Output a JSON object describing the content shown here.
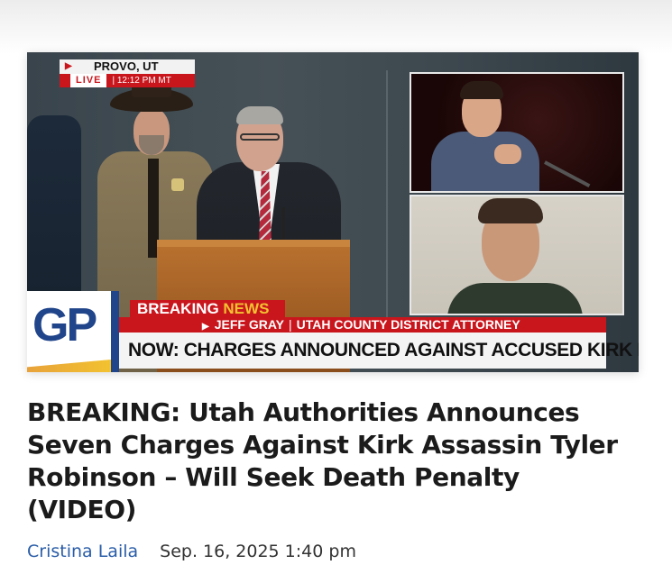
{
  "video": {
    "location": "PROVO, UT",
    "live_label": "LIVE",
    "time": "12:12 PM MT",
    "breaking_word": "BREAKING",
    "news_word": "NEWS",
    "speaker_name": "JEFF GRAY",
    "speaker_title": "UTAH COUNTY DISTRICT ATTORNEY",
    "chyron": "NOW: CHARGES ANNOUNCED AGAINST ACCUSED KIRK KILLER",
    "logo_text": "GP",
    "colors": {
      "red": "#c9161d",
      "logo_blue": "#21458a",
      "accent_yellow": "#f2c230"
    }
  },
  "article": {
    "headline": "BREAKING: Utah Authorities Announces Seven Charges Against Kirk Assassin Tyler Robinson – Will Seek Death Penalty (VIDEO)",
    "author": "Cristina Laila",
    "date": "Sep. 16, 2025 1:40 pm",
    "colors": {
      "author_link": "#2a5da8"
    }
  }
}
